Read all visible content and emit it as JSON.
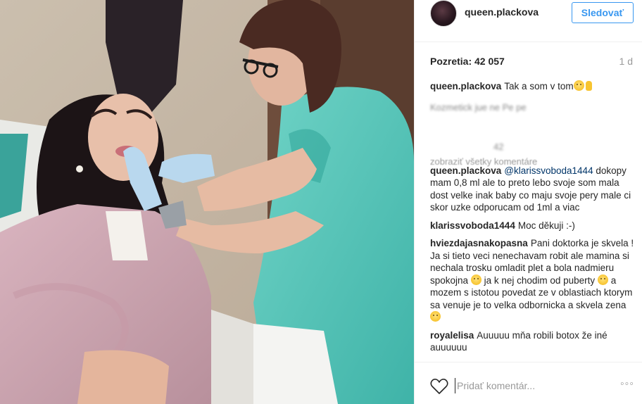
{
  "post": {
    "username": "queen.plackova",
    "follow_label": "Sledovať",
    "views": "Pozretia: 42 057",
    "age": "1 d"
  },
  "comments": [
    {
      "user": "queen.plackova",
      "text": "Tak a som v tom",
      "emoji": "laughing-emoji"
    },
    {
      "user": "queen.plackova",
      "mention": "@klarissvoboda1444",
      "text": "dokopy mam 0,8 ml ale to preto lebo svoje som mala dost velke inak baby co maju svoje pery male ci skor uzke odporucam od 1ml a viac"
    },
    {
      "user": "klarissvoboda1444",
      "text": "Moc děkuji :-)"
    },
    {
      "user": "hviezdajasnakopasna",
      "text_parts": [
        "Pani doktorka je skvela ! Ja si tieto veci nenechavam robit ale mamina si nechala trosku omladit plet a bola nadmieru spokojna",
        "ja k nej chodim od puberty",
        "a mozem s istotou povedat ze v oblastiach ktorym sa venuje je to velka odbornicka a skvela zena"
      ]
    },
    {
      "user": "royalelisa",
      "text": "Auuuuu mňa robili botox že iné auuuuuu"
    }
  ],
  "blurred": {
    "line1": "Kozmetick jue  ne      Pe    pe",
    "line2": "               42          ",
    "load_more": "zobraziť všetky komentáre"
  },
  "footer": {
    "comment_placeholder": "Pridať komentár...",
    "more_label": "ooo"
  },
  "icons": {
    "like": "heart-icon",
    "more": "more-options-icon"
  },
  "colors": {
    "accent": "#3897f0",
    "mention": "#003569",
    "muted": "#999999"
  }
}
